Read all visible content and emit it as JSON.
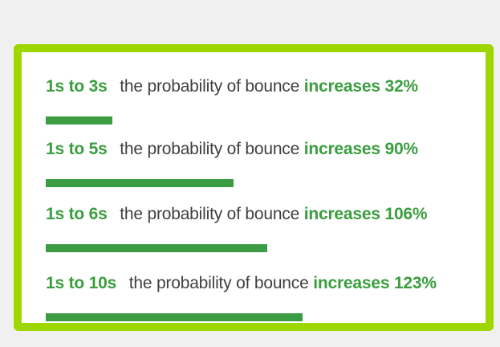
{
  "colors": {
    "frame_border": "#9ed600",
    "highlight_text": "#3a9e3f",
    "bar": "#3b9c44",
    "body_text": "#404040",
    "background": "#f0f0f0"
  },
  "rows": [
    {
      "range": "1s to 3s",
      "desc": "the probability of bounce",
      "increase": "increases 32%"
    },
    {
      "range": "1s to 5s",
      "desc": "the probability of bounce",
      "increase": "increases 90%"
    },
    {
      "range": "1s to 6s",
      "desc": "the probability of bounce",
      "increase": "increases 106%"
    },
    {
      "range": "1s to 10s",
      "desc": "the probability of bounce",
      "increase": "increases 123%"
    }
  ],
  "chart_data": {
    "type": "bar",
    "categories": [
      "1s to 3s",
      "1s to 5s",
      "1s to 6s",
      "1s to 10s"
    ],
    "values": [
      32,
      90,
      106,
      123
    ],
    "title": "",
    "xlabel": "",
    "ylabel": "",
    "unit": "%",
    "orientation": "horizontal",
    "grid": false,
    "legend": "none"
  }
}
